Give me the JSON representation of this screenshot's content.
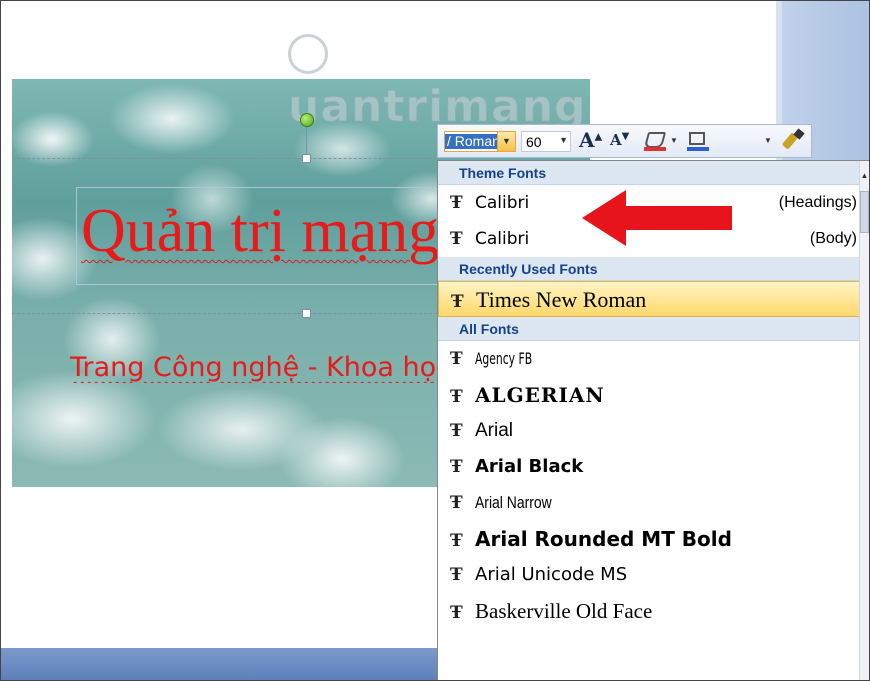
{
  "watermark": "uantrimang",
  "slide": {
    "title": "Quản trị mạng",
    "subtitle": "Trang Công nghệ - Khoa học"
  },
  "toolbar": {
    "font_value": "Times New Roman",
    "font_visible": "/ Roman",
    "size_value": "60",
    "grow_label": "A",
    "shrink_label": "A",
    "fill_color": "#e03030",
    "outline_color": "#3060d0"
  },
  "font_menu": {
    "sections": [
      {
        "header": "Theme Fonts",
        "items": [
          {
            "label": "Calibri",
            "note": "(Headings)",
            "family": "DejaVu Sans"
          },
          {
            "label": "Calibri",
            "note": "(Body)",
            "family": "DejaVu Sans"
          }
        ]
      },
      {
        "header": "Recently Used Fonts",
        "items": [
          {
            "label": "Times New Roman",
            "note": "",
            "family": "Liberation Serif",
            "selected": true
          }
        ]
      },
      {
        "header": "All Fonts",
        "items": [
          {
            "label": "Agency FB",
            "note": "",
            "family": "DejaVu Sans Condensed"
          },
          {
            "label": "ALGERIAN",
            "note": "",
            "family": "DejaVu Serif"
          },
          {
            "label": "Arial",
            "note": "",
            "family": "Liberation Sans"
          },
          {
            "label": "Arial Black",
            "note": "",
            "family": "DejaVu Sans"
          },
          {
            "label": "Arial Narrow",
            "note": "",
            "family": "Liberation Sans"
          },
          {
            "label": "Arial Rounded MT Bold",
            "note": "",
            "family": "DejaVu Sans"
          },
          {
            "label": "Arial Unicode MS",
            "note": "",
            "family": "DejaVu Sans"
          },
          {
            "label": "Baskerville Old Face",
            "note": "",
            "family": "Liberation Serif"
          }
        ]
      }
    ]
  },
  "colors": {
    "title_red": "#e81a1a",
    "header_bg": "#dde7f2",
    "header_text": "#15428b",
    "selected_bg": "#ffd86c"
  }
}
